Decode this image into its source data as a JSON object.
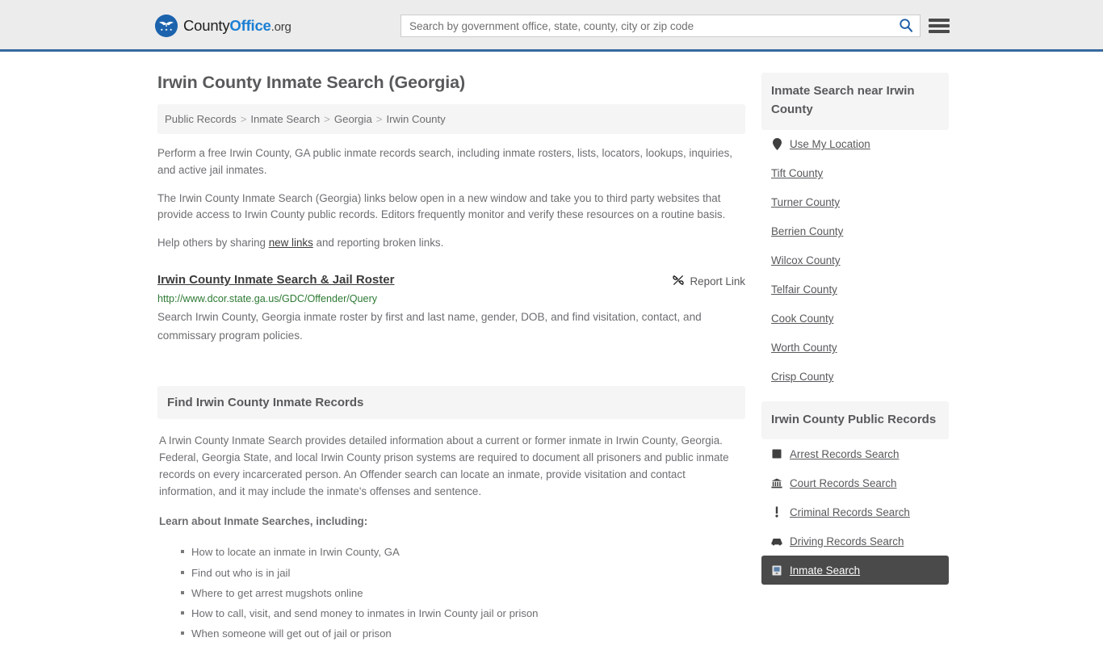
{
  "header": {
    "brand": {
      "part1": "County",
      "part2": "Office",
      "part3": ".org",
      "logo_icon": "eagle-stars-seal-icon"
    },
    "search": {
      "placeholder": "Search by government office, state, county, city or zip code",
      "value": "",
      "search_icon": "search-icon"
    },
    "menu_icon": "hamburger-menu-icon",
    "accent_color": "#36699e"
  },
  "page": {
    "title": "Irwin County Inmate Search (Georgia)",
    "breadcrumb": [
      {
        "label": "Public Records"
      },
      {
        "label": "Inmate Search"
      },
      {
        "label": "Georgia"
      },
      {
        "label": "Irwin County"
      }
    ],
    "breadcrumb_separator": ">",
    "intro_paragraphs": [
      "Perform a free Irwin County, GA public inmate records search, including inmate rosters, lists, locators, lookups, inquiries, and active jail inmates.",
      "The Irwin County Inmate Search (Georgia) links below open in a new window and take you to third party websites that provide access to Irwin County public records. Editors frequently monitor and verify these resources on a routine basis."
    ],
    "help_text_before": "Help others by sharing ",
    "help_link": "new links",
    "help_text_after": " and reporting broken links."
  },
  "result": {
    "title": "Irwin County Inmate Search & Jail Roster",
    "url": "http://www.dcor.state.ga.us/GDC/Offender/Query",
    "description": "Search Irwin County, Georgia inmate roster by first and last name, gender, DOB, and find visitation, contact, and commissary program policies.",
    "report_label": "Report Link",
    "report_icon": "broken-link-icon",
    "url_color": "#2d7a33"
  },
  "section": {
    "heading": "Find Irwin County Inmate Records",
    "paragraph": "A Irwin County Inmate Search provides detailed information about a current or former inmate in Irwin County, Georgia. Federal, Georgia State, and local Irwin County prison systems are required to document all prisoners and public inmate records on every incarcerated person. An Offender search can locate an inmate, provide visitation and contact information, and it may include the inmate's offenses and sentence.",
    "learn_title": "Learn about Inmate Searches, including:",
    "learn_items": [
      "How to locate an inmate in Irwin County, GA",
      "Find out who is in jail",
      "Where to get arrest mugshots online",
      "How to call, visit, and send money to inmates in Irwin County jail or prison",
      "When someone will get out of jail or prison"
    ]
  },
  "sidebar": {
    "nearby": {
      "heading": "Inmate Search near Irwin County",
      "items": [
        {
          "label": "Use My Location",
          "icon": "map-pin-icon"
        },
        {
          "label": "Tift County",
          "icon": ""
        },
        {
          "label": "Turner County",
          "icon": ""
        },
        {
          "label": "Berrien County",
          "icon": ""
        },
        {
          "label": "Wilcox County",
          "icon": ""
        },
        {
          "label": "Telfair County",
          "icon": ""
        },
        {
          "label": "Cook County",
          "icon": ""
        },
        {
          "label": "Worth County",
          "icon": ""
        },
        {
          "label": "Crisp County",
          "icon": ""
        }
      ]
    },
    "public_records": {
      "heading": "Irwin County Public Records",
      "items": [
        {
          "label": "Arrest Records Search",
          "icon": "fingerprint-card-icon",
          "active": false
        },
        {
          "label": "Court Records Search",
          "icon": "courthouse-icon",
          "active": false
        },
        {
          "label": "Criminal Records Search",
          "icon": "exclamation-icon",
          "active": false
        },
        {
          "label": "Driving Records Search",
          "icon": "car-icon",
          "active": false
        },
        {
          "label": "Inmate Search",
          "icon": "inmate-icon",
          "active": true
        }
      ],
      "active_bg": "#4a4a4a"
    }
  }
}
